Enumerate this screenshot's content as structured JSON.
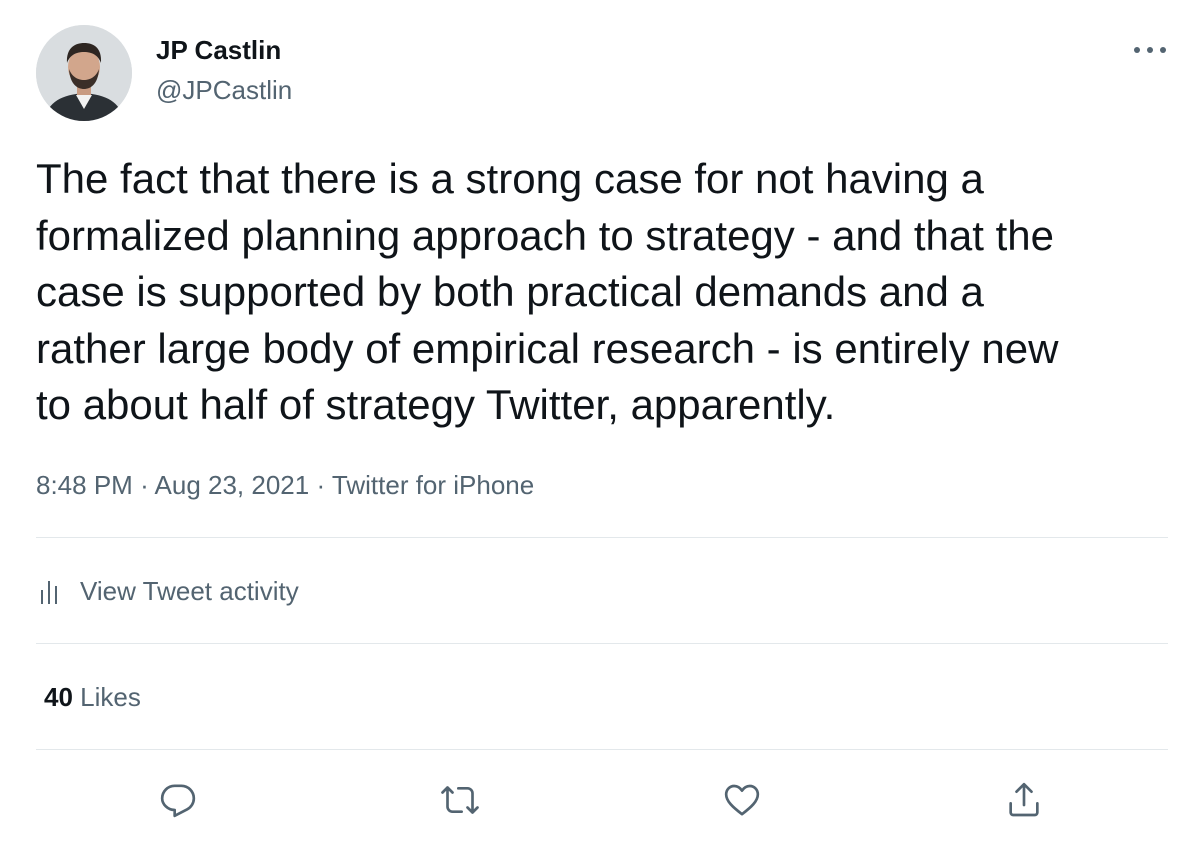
{
  "author": {
    "name": "JP Castlin",
    "handle": "@JPCastlin",
    "avatar_icon": "avatar-photo"
  },
  "tweet": {
    "text": "The fact that there is a strong case for not having a\nformalized planning approach to strategy - and that the\ncase is supported by both practical demands and a\nrather large body of empirical research - is entirely new\nto about half of strategy Twitter, apparently.",
    "time": "8:48 PM",
    "date": "Aug 23, 2021",
    "separator": "·",
    "source": "Twitter for iPhone"
  },
  "activity": {
    "label": "View Tweet activity",
    "icon": "bar-chart-icon"
  },
  "stats": {
    "likes_count": "40",
    "likes_label": "Likes"
  },
  "actions": [
    {
      "name": "reply",
      "icon": "reply-icon"
    },
    {
      "name": "retweet",
      "icon": "retweet-icon"
    },
    {
      "name": "like",
      "icon": "heart-icon"
    },
    {
      "name": "share",
      "icon": "share-icon"
    }
  ],
  "colors": {
    "text_primary": "#0f1419",
    "text_secondary": "#536471",
    "divider": "#e3e8eb"
  }
}
